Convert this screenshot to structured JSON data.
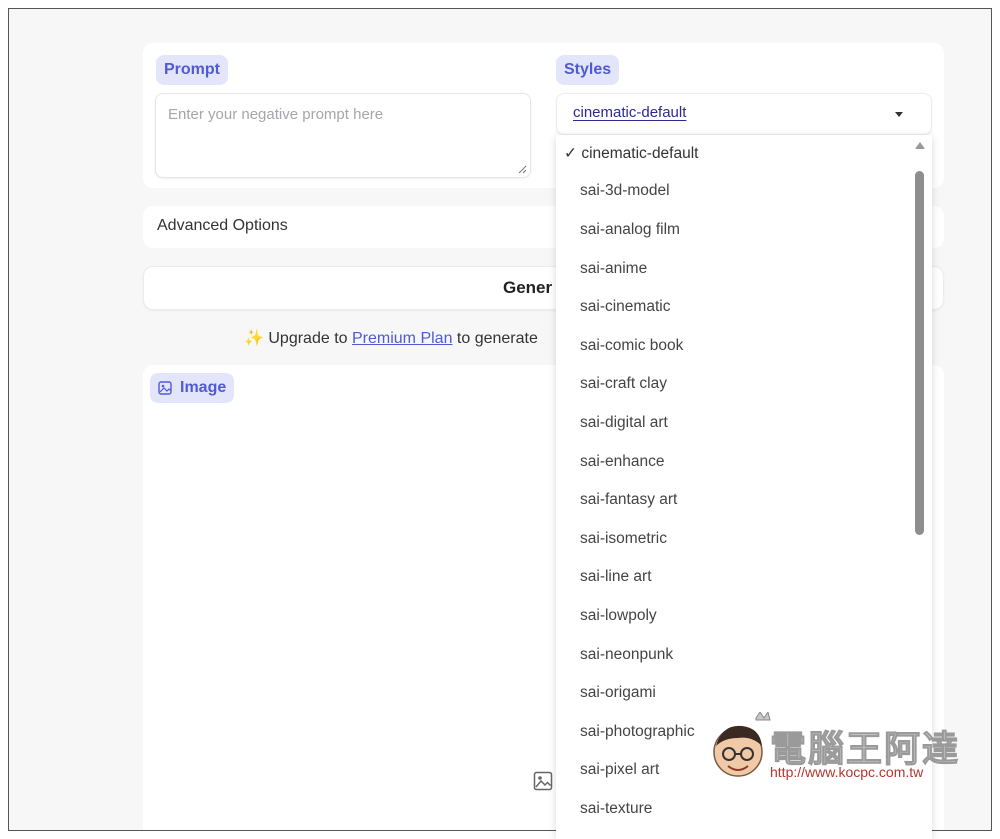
{
  "prompt_section": {
    "label": "Prompt",
    "textarea_placeholder": "Enter your negative prompt here"
  },
  "styles_section": {
    "label": "Styles",
    "selected_value": "cinematic-default"
  },
  "advanced_options": {
    "label": "Advanced Options"
  },
  "generate_button": {
    "label": "Gener"
  },
  "upgrade_notice": {
    "icon": "✨",
    "prefix": "Upgrade to ",
    "link_text": "Premium Plan",
    "suffix": " to generate"
  },
  "image_section": {
    "label": "Image"
  },
  "styles_dropdown": {
    "check_mark": "✓",
    "options": [
      "cinematic-default",
      "sai-3d-model",
      "sai-analog film",
      "sai-anime",
      "sai-cinematic",
      "sai-comic book",
      "sai-craft clay",
      "sai-digital art",
      "sai-enhance",
      "sai-fantasy art",
      "sai-isometric",
      "sai-line art",
      "sai-lowpoly",
      "sai-neonpunk",
      "sai-origami",
      "sai-photographic",
      "sai-pixel art",
      "sai-texture"
    ]
  },
  "watermark": {
    "title": "電腦王阿達",
    "url": "http://www.kocpc.com.tw"
  },
  "colors": {
    "accent": "#4f5bd5",
    "pill_bg": "#e3e6fb",
    "page_bg": "#f7f7f8"
  }
}
